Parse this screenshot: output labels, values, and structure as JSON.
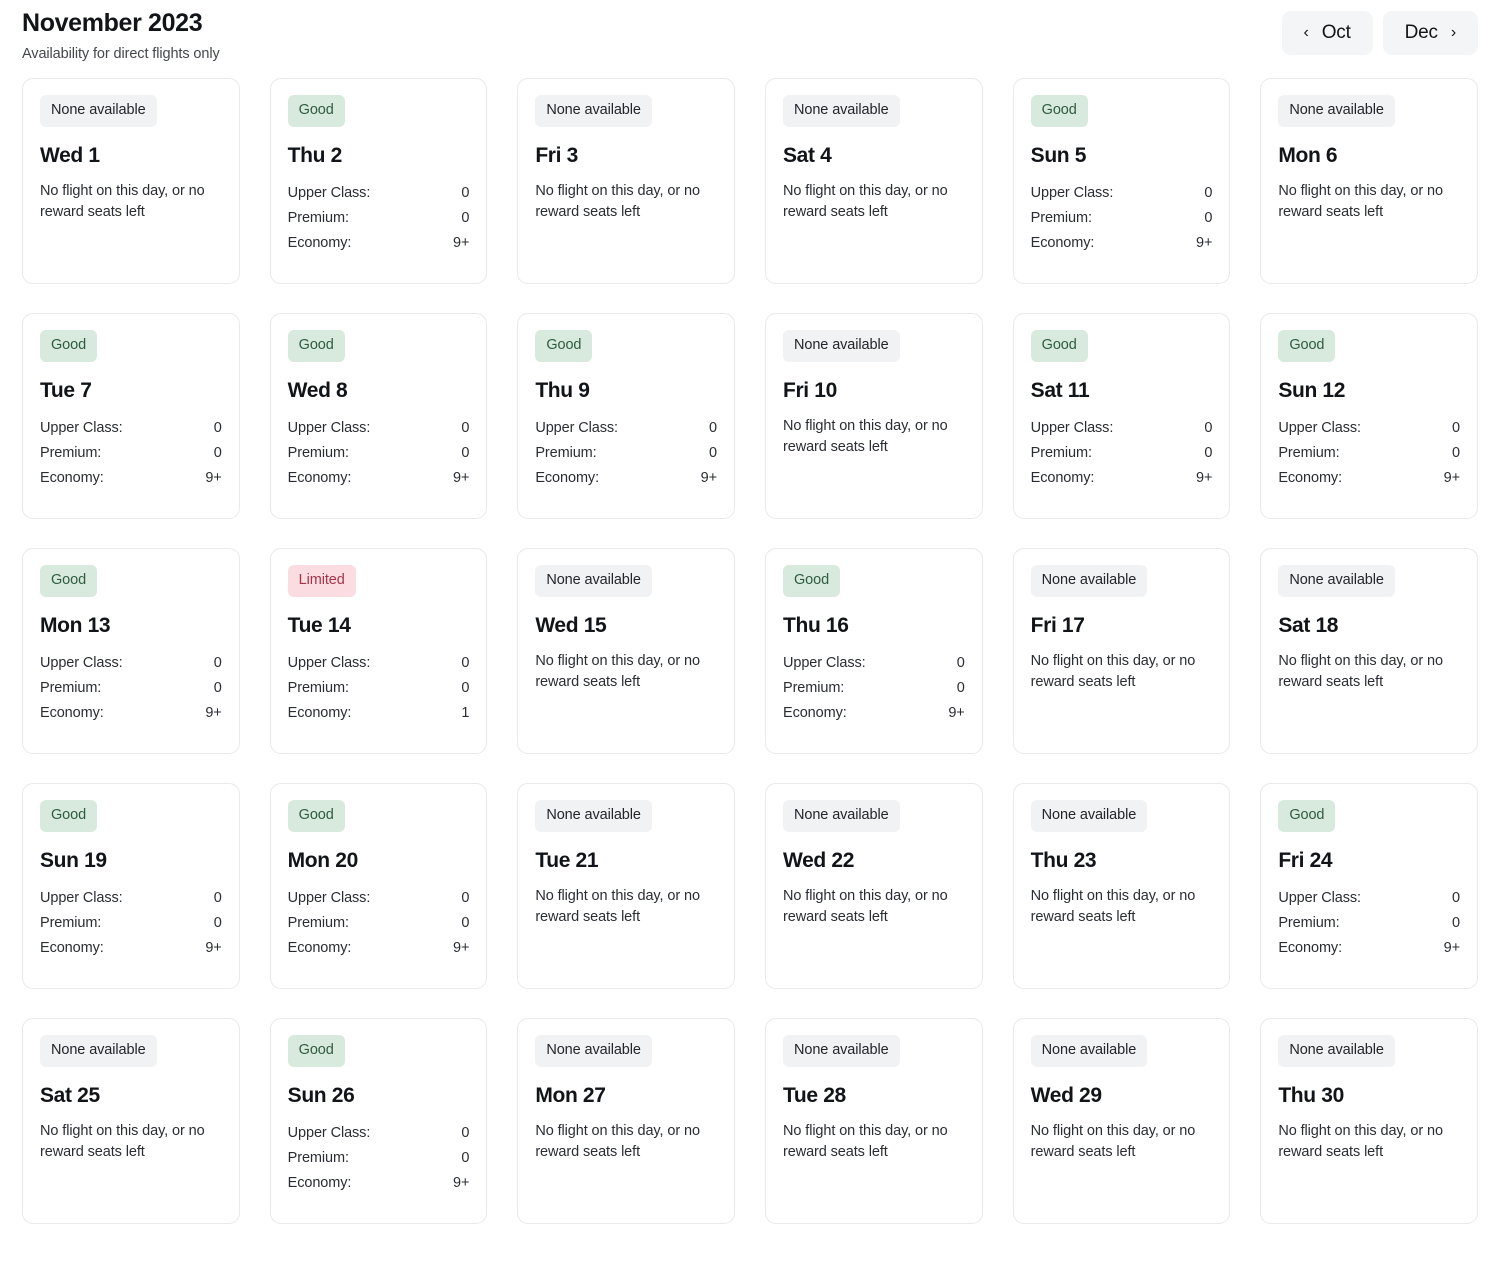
{
  "header": {
    "month_title": "November 2023",
    "subtitle": "Availability for direct flights only",
    "prev_label": "Oct",
    "next_label": "Dec",
    "prev_chevron": "‹",
    "next_chevron": "›"
  },
  "labels": {
    "no_flight_text": "No flight on this day, or no reward seats left",
    "badge_none": "None available",
    "badge_good": "Good",
    "badge_limited": "Limited",
    "cabin_upper": "Upper Class:",
    "cabin_premium": "Premium:",
    "cabin_economy": "Economy:"
  },
  "colors": {
    "badge_good_bg": "#d8eadd",
    "badge_good_fg": "#2f5c40",
    "badge_limited_bg": "#fbdde1",
    "badge_limited_fg": "#a3344a",
    "badge_none_bg": "#f1f2f4",
    "badge_none_fg": "#22252a",
    "card_border": "#e8e9eb",
    "page_bg": "#ffffff"
  },
  "days": [
    {
      "day": "Wed 1",
      "status": "none",
      "badge": "None available",
      "message": "No flight on this day, or no reward seats left"
    },
    {
      "day": "Thu 2",
      "status": "good",
      "badge": "Good",
      "cabins": [
        {
          "name": "Upper Class:",
          "value": "0"
        },
        {
          "name": "Premium:",
          "value": "0"
        },
        {
          "name": "Economy:",
          "value": "9+"
        }
      ]
    },
    {
      "day": "Fri 3",
      "status": "none",
      "badge": "None available",
      "message": "No flight on this day, or no reward seats left"
    },
    {
      "day": "Sat 4",
      "status": "none",
      "badge": "None available",
      "message": "No flight on this day, or no reward seats left"
    },
    {
      "day": "Sun 5",
      "status": "good",
      "badge": "Good",
      "cabins": [
        {
          "name": "Upper Class:",
          "value": "0"
        },
        {
          "name": "Premium:",
          "value": "0"
        },
        {
          "name": "Economy:",
          "value": "9+"
        }
      ]
    },
    {
      "day": "Mon 6",
      "status": "none",
      "badge": "None available",
      "message": "No flight on this day, or no reward seats left"
    },
    {
      "day": "Tue 7",
      "status": "good",
      "badge": "Good",
      "cabins": [
        {
          "name": "Upper Class:",
          "value": "0"
        },
        {
          "name": "Premium:",
          "value": "0"
        },
        {
          "name": "Economy:",
          "value": "9+"
        }
      ]
    },
    {
      "day": "Wed 8",
      "status": "good",
      "badge": "Good",
      "cabins": [
        {
          "name": "Upper Class:",
          "value": "0"
        },
        {
          "name": "Premium:",
          "value": "0"
        },
        {
          "name": "Economy:",
          "value": "9+"
        }
      ]
    },
    {
      "day": "Thu 9",
      "status": "good",
      "badge": "Good",
      "cabins": [
        {
          "name": "Upper Class:",
          "value": "0"
        },
        {
          "name": "Premium:",
          "value": "0"
        },
        {
          "name": "Economy:",
          "value": "9+"
        }
      ]
    },
    {
      "day": "Fri 10",
      "status": "none",
      "badge": "None available",
      "message": "No flight on this day, or no reward seats left"
    },
    {
      "day": "Sat 11",
      "status": "good",
      "badge": "Good",
      "cabins": [
        {
          "name": "Upper Class:",
          "value": "0"
        },
        {
          "name": "Premium:",
          "value": "0"
        },
        {
          "name": "Economy:",
          "value": "9+"
        }
      ]
    },
    {
      "day": "Sun 12",
      "status": "good",
      "badge": "Good",
      "cabins": [
        {
          "name": "Upper Class:",
          "value": "0"
        },
        {
          "name": "Premium:",
          "value": "0"
        },
        {
          "name": "Economy:",
          "value": "9+"
        }
      ]
    },
    {
      "day": "Mon 13",
      "status": "good",
      "badge": "Good",
      "cabins": [
        {
          "name": "Upper Class:",
          "value": "0"
        },
        {
          "name": "Premium:",
          "value": "0"
        },
        {
          "name": "Economy:",
          "value": "9+"
        }
      ]
    },
    {
      "day": "Tue 14",
      "status": "limited",
      "badge": "Limited",
      "cabins": [
        {
          "name": "Upper Class:",
          "value": "0"
        },
        {
          "name": "Premium:",
          "value": "0"
        },
        {
          "name": "Economy:",
          "value": "1"
        }
      ]
    },
    {
      "day": "Wed 15",
      "status": "none",
      "badge": "None available",
      "message": "No flight on this day, or no reward seats left"
    },
    {
      "day": "Thu 16",
      "status": "good",
      "badge": "Good",
      "cabins": [
        {
          "name": "Upper Class:",
          "value": "0"
        },
        {
          "name": "Premium:",
          "value": "0"
        },
        {
          "name": "Economy:",
          "value": "9+"
        }
      ]
    },
    {
      "day": "Fri 17",
      "status": "none",
      "badge": "None available",
      "message": "No flight on this day, or no reward seats left"
    },
    {
      "day": "Sat 18",
      "status": "none",
      "badge": "None available",
      "message": "No flight on this day, or no reward seats left"
    },
    {
      "day": "Sun 19",
      "status": "good",
      "badge": "Good",
      "cabins": [
        {
          "name": "Upper Class:",
          "value": "0"
        },
        {
          "name": "Premium:",
          "value": "0"
        },
        {
          "name": "Economy:",
          "value": "9+"
        }
      ]
    },
    {
      "day": "Mon 20",
      "status": "good",
      "badge": "Good",
      "cabins": [
        {
          "name": "Upper Class:",
          "value": "0"
        },
        {
          "name": "Premium:",
          "value": "0"
        },
        {
          "name": "Economy:",
          "value": "9+"
        }
      ]
    },
    {
      "day": "Tue 21",
      "status": "none",
      "badge": "None available",
      "message": "No flight on this day, or no reward seats left"
    },
    {
      "day": "Wed 22",
      "status": "none",
      "badge": "None available",
      "message": "No flight on this day, or no reward seats left"
    },
    {
      "day": "Thu 23",
      "status": "none",
      "badge": "None available",
      "message": "No flight on this day, or no reward seats left"
    },
    {
      "day": "Fri 24",
      "status": "good",
      "badge": "Good",
      "cabins": [
        {
          "name": "Upper Class:",
          "value": "0"
        },
        {
          "name": "Premium:",
          "value": "0"
        },
        {
          "name": "Economy:",
          "value": "9+"
        }
      ]
    },
    {
      "day": "Sat 25",
      "status": "none",
      "badge": "None available",
      "message": "No flight on this day, or no reward seats left"
    },
    {
      "day": "Sun 26",
      "status": "good",
      "badge": "Good",
      "cabins": [
        {
          "name": "Upper Class:",
          "value": "0"
        },
        {
          "name": "Premium:",
          "value": "0"
        },
        {
          "name": "Economy:",
          "value": "9+"
        }
      ]
    },
    {
      "day": "Mon 27",
      "status": "none",
      "badge": "None available",
      "message": "No flight on this day, or no reward seats left"
    },
    {
      "day": "Tue 28",
      "status": "none",
      "badge": "None available",
      "message": "No flight on this day, or no reward seats left"
    },
    {
      "day": "Wed 29",
      "status": "none",
      "badge": "None available",
      "message": "No flight on this day, or no reward seats left"
    },
    {
      "day": "Thu 30",
      "status": "none",
      "badge": "None available",
      "message": "No flight on this day, or no reward seats left"
    }
  ]
}
